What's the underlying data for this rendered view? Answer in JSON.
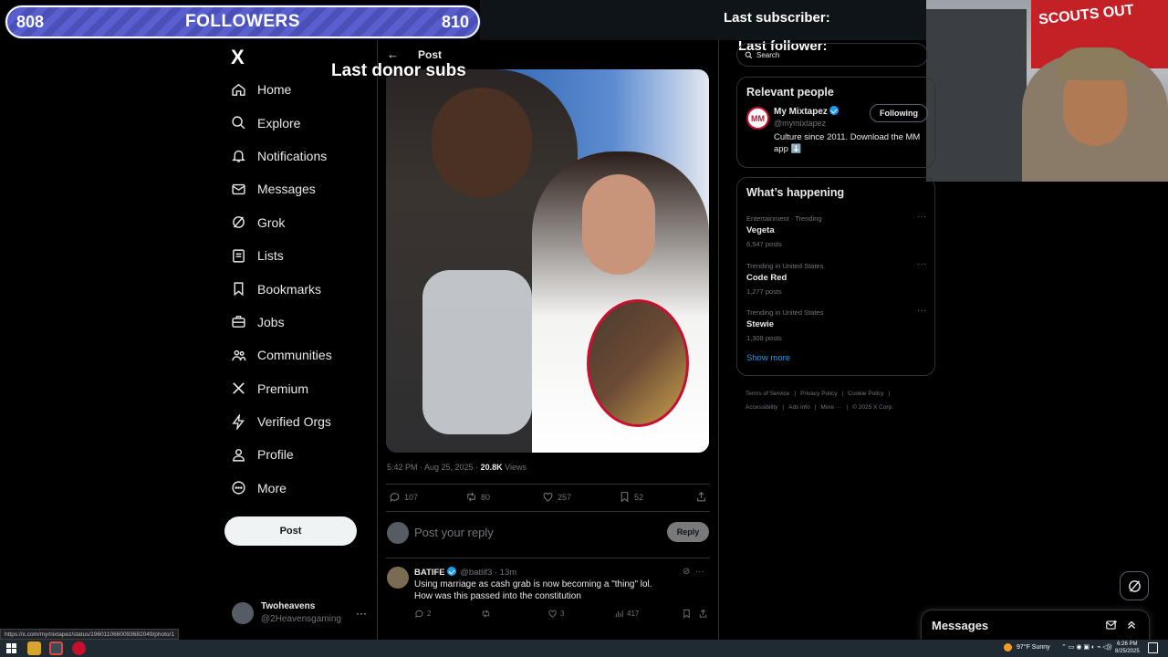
{
  "overlay": {
    "followers_current": "808",
    "followers_label": "FOLLOWERS",
    "followers_goal": "810",
    "last_subscriber": "Last subscriber:",
    "last_follower": "Last follower:",
    "last_donor": "Last donor subs",
    "webcam_flag_text": "SCOUTS OUT"
  },
  "sidebar": {
    "logo": "X",
    "items": [
      {
        "label": "Home",
        "icon": "home-icon"
      },
      {
        "label": "Explore",
        "icon": "search-icon"
      },
      {
        "label": "Notifications",
        "icon": "bell-icon"
      },
      {
        "label": "Messages",
        "icon": "envelope-icon"
      },
      {
        "label": "Grok",
        "icon": "grok-icon"
      },
      {
        "label": "Lists",
        "icon": "list-icon"
      },
      {
        "label": "Bookmarks",
        "icon": "bookmark-icon"
      },
      {
        "label": "Jobs",
        "icon": "briefcase-icon"
      },
      {
        "label": "Communities",
        "icon": "people-icon"
      },
      {
        "label": "Premium",
        "icon": "x-logo-icon"
      },
      {
        "label": "Verified Orgs",
        "icon": "lightning-icon"
      },
      {
        "label": "Profile",
        "icon": "person-icon"
      },
      {
        "label": "More",
        "icon": "more-circle-icon"
      }
    ],
    "post_button": "Post",
    "account": {
      "name": "Twoheavens",
      "handle": "@2Heavensgaming",
      "more": "···"
    }
  },
  "post": {
    "header_title": "Post",
    "back": "←",
    "meta_time": "5:42 PM · Aug 25, 2025 · ",
    "views_count": "20.8K",
    "views_label": " Views",
    "stats": {
      "replies": "107",
      "reposts": "80",
      "likes": "257",
      "bookmarks": "52"
    },
    "reply_placeholder": "Post your reply",
    "reply_button": "Reply"
  },
  "replies": [
    {
      "name": "BATIFE",
      "handle": "@batlif3 · 13m",
      "text": "Using marriage as cash grab is now becoming a \"thing\" lol. How was this passed into the constitution",
      "stats": {
        "replies": "2",
        "likes": "3",
        "views": "417"
      }
    }
  ],
  "right": {
    "search_placeholder": "Search",
    "relevant_title": "Relevant people",
    "relevant": {
      "logo": "MM",
      "name": "My Mixtapez",
      "handle": "@mymixtapez",
      "bio": "Culture since 2011. Download the MM app ⬇️",
      "button": "Following"
    },
    "happening_title": "What’s happening",
    "trends": [
      {
        "context": "Entertainment · Trending",
        "title": "Vegeta",
        "count": "6,547 posts"
      },
      {
        "context": "Trending in United States",
        "title": "Code Red",
        "count": "1,277 posts"
      },
      {
        "context": "Trending in United States",
        "title": "Stewie",
        "count": "1,308 posts"
      }
    ],
    "show_more": "Show more",
    "footer": {
      "terms": "Terms of Service",
      "privacy": "Privacy Policy",
      "cookie": "Cookie Policy",
      "accessibility": "Accessibility",
      "ads": "Ads info",
      "more": "More ···",
      "copyright": "© 2025 X Corp."
    }
  },
  "messages_drawer": {
    "title": "Messages"
  },
  "status_url": "https://x.com/mymixtapez/status/1960110660093682049/photo/1",
  "taskbar": {
    "weather": "97°F  Sunny",
    "time": "6:26 PM",
    "date": "8/25/2025"
  },
  "colors": {
    "accent": "#1d9bf0",
    "background": "#000000",
    "text": "#e7e9ea",
    "muted": "#71767b",
    "border": "#2f3336",
    "overlay_bar": "#5a5fd0",
    "inset_border": "#c8102e"
  }
}
